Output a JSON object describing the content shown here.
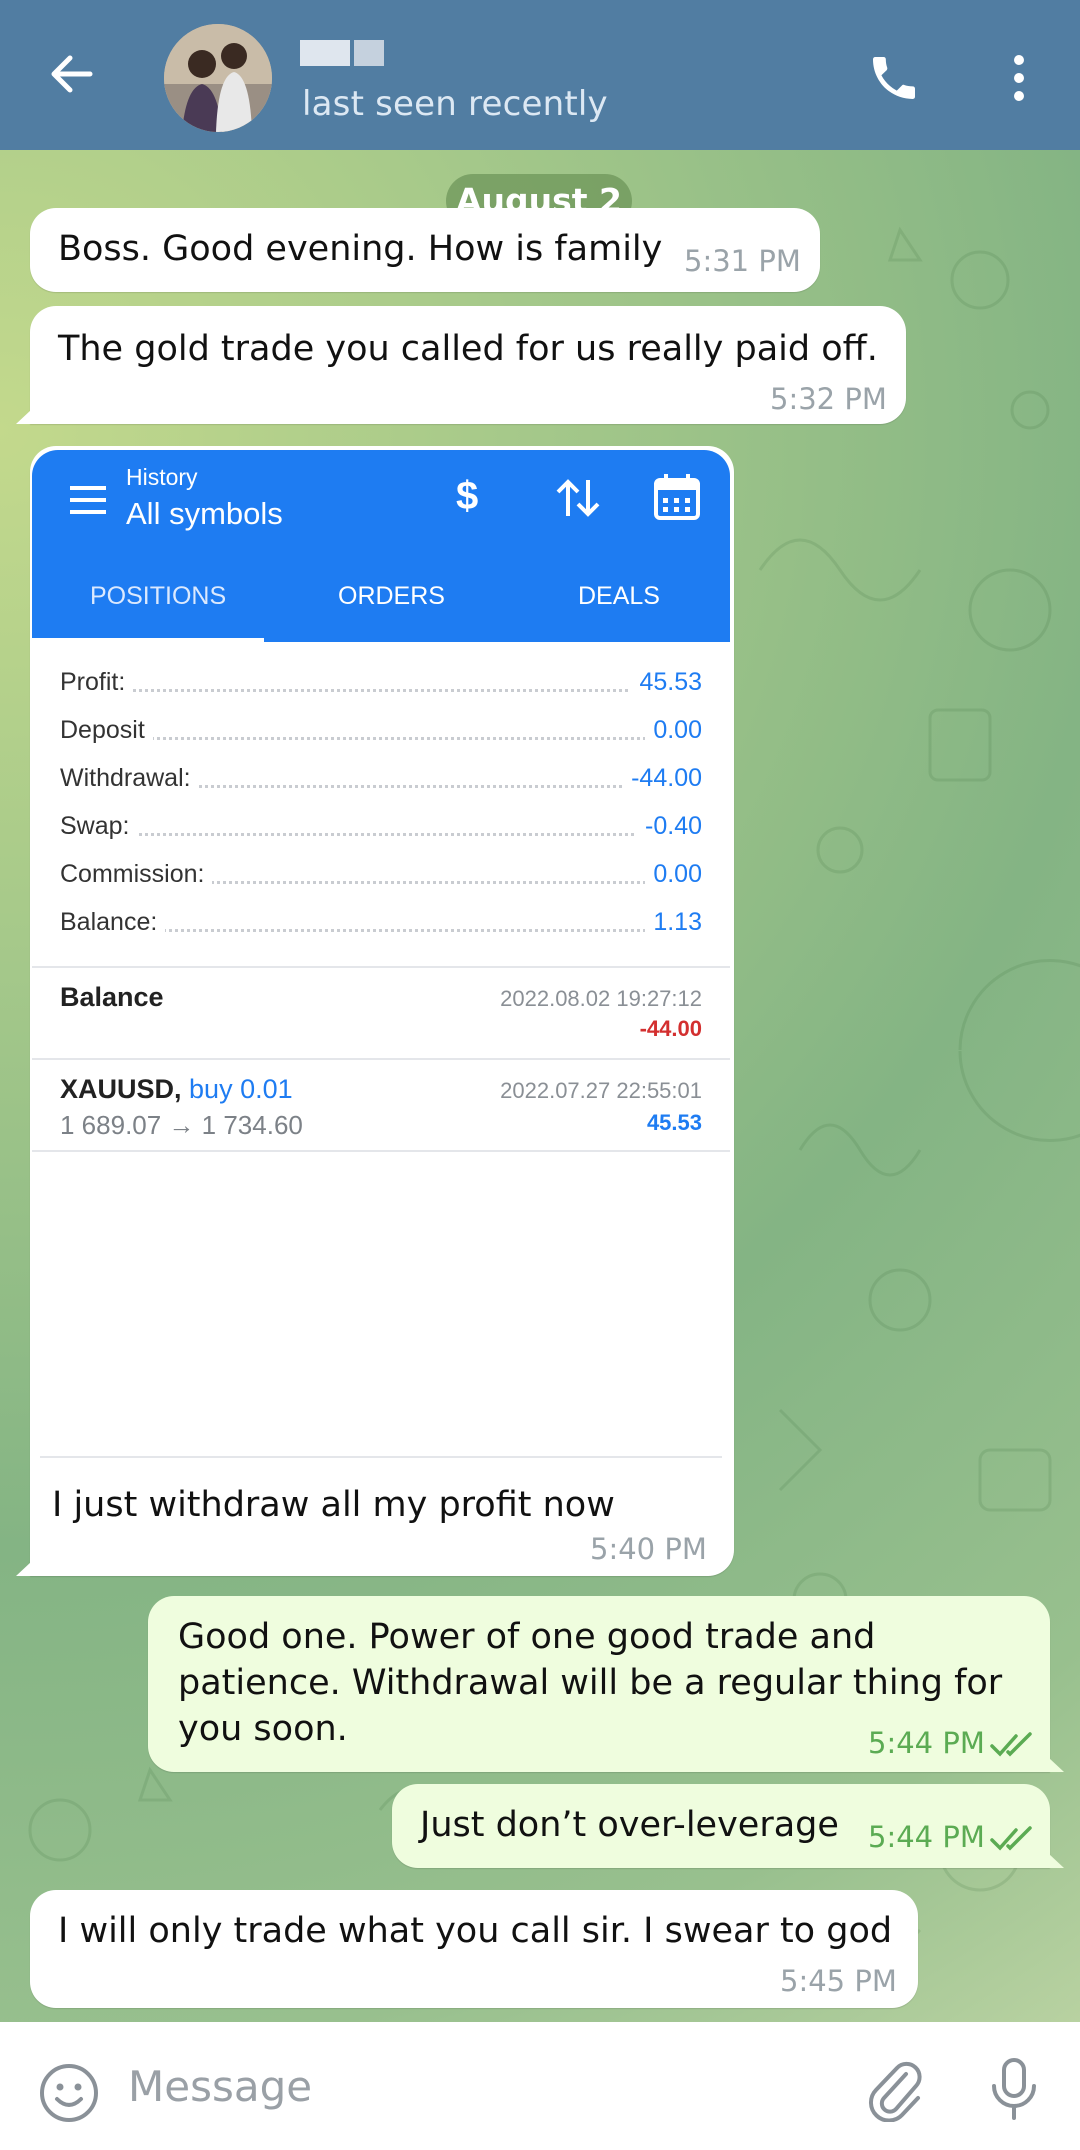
{
  "header": {
    "status": "last seen recently",
    "icons": [
      "back-arrow-icon",
      "phone-icon",
      "more-vert-icon"
    ]
  },
  "date_separator": "August 2",
  "messages": [
    {
      "text": "Boss. Good evening. How is family",
      "time": "5:31 PM",
      "direction": "incoming"
    },
    {
      "text": "The gold trade you called for us really paid off.",
      "time": "5:32 PM",
      "direction": "incoming"
    },
    {
      "text": "I just withdraw all my profit now",
      "time": "5:40 PM",
      "direction": "incoming"
    },
    {
      "text": "Good one. Power of one good trade and\npatience. Withdrawal will be a regular thing for\nyou soon.",
      "time": "5:44 PM",
      "direction": "outgoing"
    },
    {
      "text": "Just don’t over-leverage",
      "time": "5:44 PM",
      "direction": "outgoing"
    },
    {
      "text": "I will only trade what you call sir. I swear to god",
      "time": "5:45 PM",
      "direction": "incoming"
    }
  ],
  "screenshot": {
    "header_small": "History",
    "header_title": "All symbols",
    "tabs": [
      "POSITIONS",
      "ORDERS",
      "DEALS"
    ],
    "summary": [
      {
        "label": "Profit:",
        "value": "45.53"
      },
      {
        "label": "Deposit",
        "value": "0.00"
      },
      {
        "label": "Withdrawal:",
        "value": "-44.00"
      },
      {
        "label": "Swap:",
        "value": "-0.40"
      },
      {
        "label": "Commission:",
        "value": "0.00"
      },
      {
        "label": "Balance:",
        "value": "1.13"
      }
    ],
    "deals": [
      {
        "title": "Balance",
        "date": "2022.08.02 19:27:12",
        "amount": "-44.00",
        "amount_color": "#d32f2f"
      },
      {
        "symbol": "XAUUSD,",
        "side": "buy 0.01",
        "prices": "1 689.07 → 1 734.60",
        "date": "2022.07.27 22:55:01",
        "amount": "45.53",
        "amount_color": "#1e7cf2"
      }
    ]
  },
  "input": {
    "placeholder": "Message"
  },
  "colors": {
    "header": "#517da2",
    "outgoing_bubble": "#effdde",
    "incoming_bubble": "#ffffff",
    "mt_blue": "#1e7cf2"
  }
}
